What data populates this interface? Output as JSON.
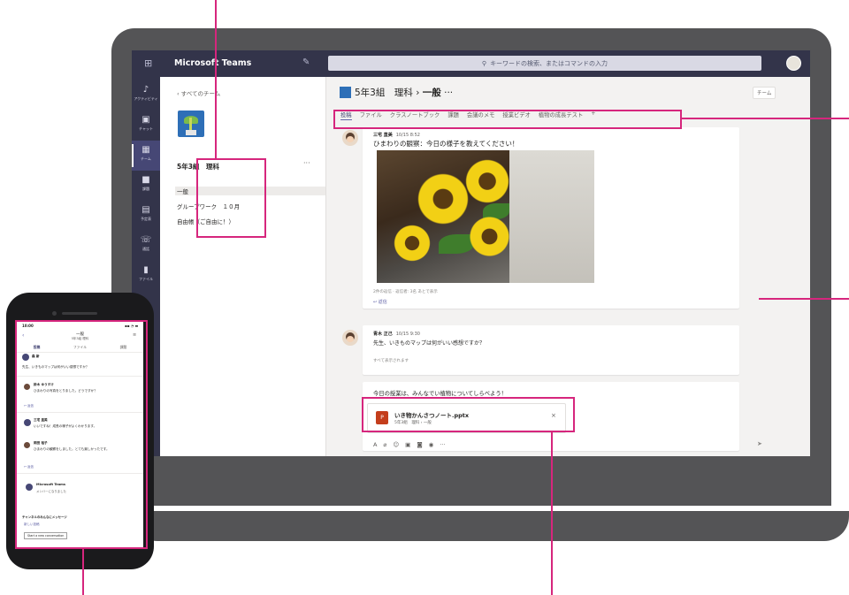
{
  "topbar": {
    "brand": "Microsoft Teams",
    "search_placeholder": "キーワードの検索、またはコマンドの入力"
  },
  "appbar": {
    "items": [
      {
        "label": "アクティビティ"
      },
      {
        "label": "チャット"
      },
      {
        "label": "チーム"
      },
      {
        "label": "課題"
      },
      {
        "label": "予定表"
      },
      {
        "label": "通話"
      },
      {
        "label": "ファイル"
      }
    ]
  },
  "team_panel": {
    "back_label": "すべてのチーム",
    "team_name": "5年3組　理科",
    "more": "···",
    "channels": [
      "一般",
      "グループワーク　１０月",
      "自由帳（ご自由に！）"
    ]
  },
  "channel": {
    "team": "5年3組　理科",
    "separator": "›",
    "name": "一般",
    "more": "···",
    "team_button": "チーム",
    "tabs": [
      "投稿",
      "ファイル",
      "クラスノートブック",
      "課題",
      "会議のメモ",
      "授業ビデオ",
      "植物の成長テスト",
      "+"
    ]
  },
  "posts": [
    {
      "author": "三宅 直美",
      "time": "10/15 8:52",
      "text": "ひまわりの観察：今日の様子を教えてください！",
      "seen": "2件の返信 · 返信者: 3名 あとで表示",
      "reply": "↩ 返信"
    },
    {
      "author": "青木 正己",
      "time": "10/15 9:30",
      "text": "先生、いきものマップは何がいい感想ですか？",
      "seen": "すべて表示されます"
    }
  ],
  "compose": {
    "text": "今日の授業は、みんなでい植物についてしらべよう！",
    "attachment_name": "いき物かんさつノート.pptx",
    "attachment_sub": "5年3組　理科 › 一般",
    "close": "×",
    "send": "➤"
  },
  "phone": {
    "time": "10:00",
    "signal": "▪▪ ◔ ▬",
    "title": "一般",
    "subtitle": "5年3組 理科",
    "tabs": [
      "投稿",
      "ファイル",
      "課題"
    ],
    "messages": [
      {
        "author": "森 新",
        "text": "先生、いきものマップは何がいい感想ですか？"
      },
      {
        "author": "鈴木 ゆうすけ",
        "text": "ひまわりの写真をとりました。どうですか？"
      },
      {
        "author": "三宅 直美",
        "text": "いいですね！成長の様子がよくわかります。"
      },
      {
        "author": "岡田 裕子",
        "text": "ひまわりの観察をしました。とても楽しかったです。"
      }
    ],
    "reply": "↩ 返信",
    "teams_member": "Microsoft Teams",
    "teams_member_sub": "メンバーになりました",
    "prompt": "チャンネルのみんなにメッセージ",
    "new_post": "新しい投稿",
    "button": "Start a new conversation"
  },
  "colors": {
    "accent": "#6264a7",
    "callout": "#d6267d",
    "appbar": "#33344a"
  }
}
